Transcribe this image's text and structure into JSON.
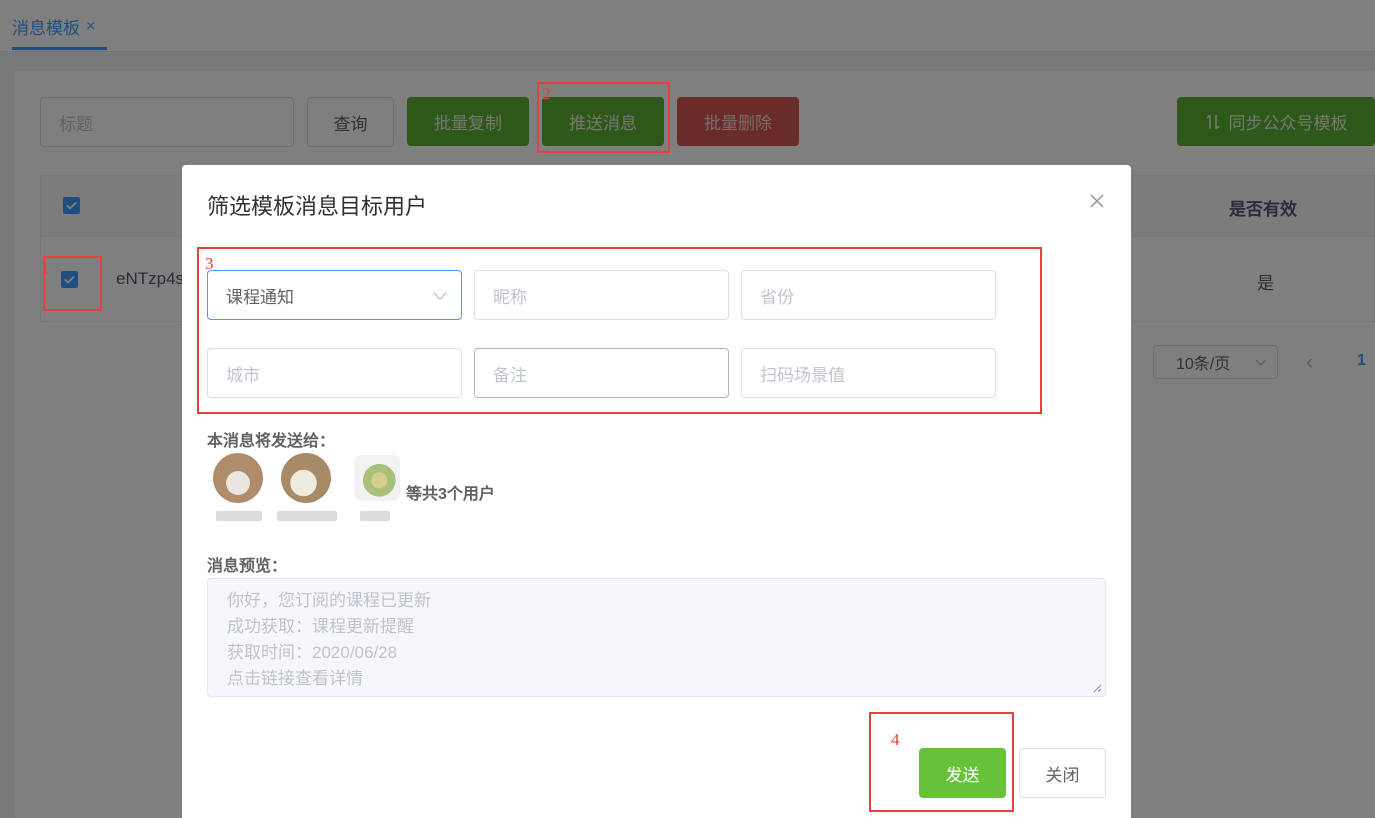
{
  "tab": {
    "label": "消息模板",
    "close": "×"
  },
  "toolbar": {
    "title_placeholder": "标题",
    "query_label": "查询",
    "batch_copy_label": "批量复制",
    "push_label": "推送消息",
    "batch_delete_label": "批量删除",
    "sync_label": "同步公众号模板",
    "sync_icon": "sort-icon"
  },
  "table": {
    "header_valid": "是否有效",
    "row_id": "eNTzp4s",
    "row_valid": "是"
  },
  "pagination": {
    "page_size": "10条/页",
    "prev": "‹",
    "page": "1"
  },
  "annotations": {
    "a1": "1",
    "a2": "2",
    "a3": "3",
    "a4": "4"
  },
  "modal": {
    "title": "筛选模板消息目标用户",
    "close": "×",
    "filters": {
      "template_value": "课程通知",
      "nickname_placeholder": "昵称",
      "province_placeholder": "省份",
      "city_placeholder": "城市",
      "remark_placeholder": "备注",
      "scene_placeholder": "扫码场景值"
    },
    "send_to_label": "本消息将发送给：",
    "users_total": "等共3个用户",
    "preview_label": "消息预览：",
    "preview_lines": [
      "你好，您订阅的课程已更新",
      "成功获取：课程更新提醒",
      "获取时间：2020/06/28",
      "点击链接查看详情"
    ],
    "send_label": "发送",
    "close_label": "关闭"
  },
  "colors": {
    "primary": "#409eff",
    "success": "#67c23a",
    "danger": "#d45656",
    "annotation": "#e84040"
  }
}
